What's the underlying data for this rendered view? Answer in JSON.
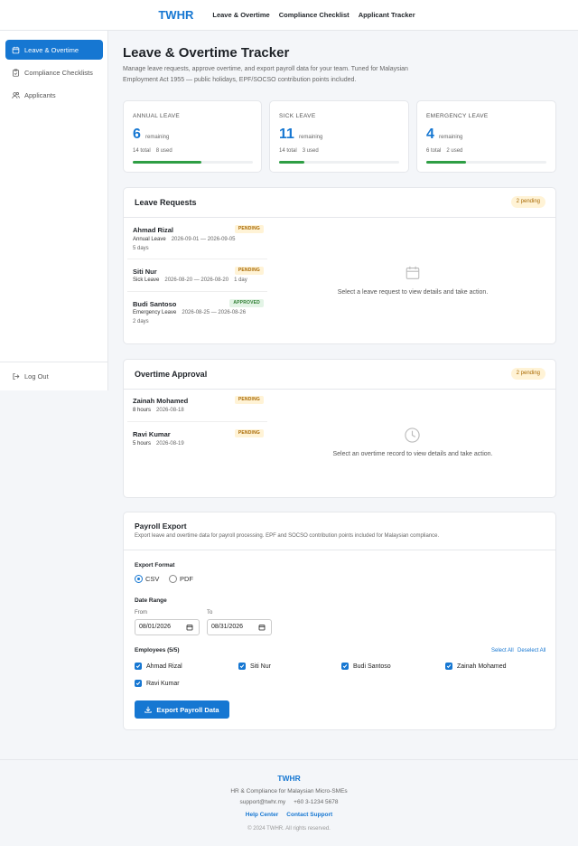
{
  "topnav": {
    "brand": "TWHR",
    "links": [
      "Leave & Overtime",
      "Compliance Checklist",
      "Applicant Tracker"
    ]
  },
  "sidebar": {
    "items": [
      {
        "label": "Leave & Overtime",
        "icon": "calendar-icon",
        "active": true
      },
      {
        "label": "Compliance Checklists",
        "icon": "clipboard-icon"
      },
      {
        "label": "Applicants",
        "icon": "users-icon"
      }
    ],
    "logout": "Log Out"
  },
  "page": {
    "title": "Leave & Overtime Tracker",
    "description": "Manage leave requests, approve overtime, and export payroll data for your team. Tuned for Malaysian Employment Act 1955 — public holidays, EPF/SOCSO contribution points included."
  },
  "stats": [
    {
      "label": "ANNUAL LEAVE",
      "value": "6",
      "remaining": "remaining",
      "total": "14 total",
      "used": "8 used",
      "progress": 0.57
    },
    {
      "label": "SICK LEAVE",
      "value": "11",
      "remaining": "remaining",
      "total": "14 total",
      "used": "3 used",
      "progress": 0.21
    },
    {
      "label": "EMERGENCY LEAVE",
      "value": "4",
      "remaining": "remaining",
      "total": "6 total",
      "used": "2 used",
      "progress": 0.33
    }
  ],
  "leave": {
    "title": "Leave Requests",
    "pending": "2 pending",
    "rows": [
      {
        "name": "Ahmad Rizal",
        "status": "PENDING",
        "type": "Annual Leave",
        "dates": "2026-09-01 — 2026-09-05",
        "days": "5 days"
      },
      {
        "name": "Siti Nur",
        "status": "PENDING",
        "type": "Sick Leave",
        "dates": "2026-08-20 — 2026-08-20",
        "days": "1 day"
      },
      {
        "name": "Budi Santoso",
        "status": "APPROVED",
        "type": "Emergency Leave",
        "dates": "2026-08-25 — 2026-08-26",
        "days": "2 days"
      }
    ],
    "empty": "Select a leave request to view details and take action."
  },
  "overtime": {
    "title": "Overtime Approval",
    "pending": "2 pending",
    "rows": [
      {
        "name": "Zainah Mohamed",
        "status": "PENDING",
        "hours": "8 hours",
        "date": "2026-08-18"
      },
      {
        "name": "Ravi Kumar",
        "status": "PENDING",
        "hours": "5 hours",
        "date": "2026-08-19"
      }
    ],
    "empty": "Select an overtime record to view details and take action."
  },
  "payroll": {
    "title": "Payroll Export",
    "description": "Export leave and overtime data for payroll processing. EPF and SOCSO contribution points included for Malaysian compliance.",
    "format_label": "Export Format",
    "formats": [
      "CSV",
      "PDF"
    ],
    "selected_format": "CSV",
    "range_label": "Date Range",
    "from_label": "From",
    "to_label": "To",
    "from": "08/01/2026",
    "to": "08/31/2026",
    "employees_label": "Employees (5/5)",
    "select_all": "Select All",
    "deselect_all": "Deselect All",
    "employees": [
      "Ahmad Rizal",
      "Siti Nur",
      "Budi Santoso",
      "Zainah Mohamed",
      "Ravi Kumar"
    ],
    "export_button": "Export Payroll Data"
  },
  "footer": {
    "brand": "TWHR",
    "tagline": "HR & Compliance for Malaysian Micro-SMEs",
    "email": "support@twhr.my",
    "phone": "+60 3-1234 5678",
    "links": [
      "Help Center",
      "Contact Support"
    ],
    "copyright": "© 2024 TWHR. All rights reserved."
  },
  "colors": {
    "accent": "#1677d2",
    "success": "#2e9e44",
    "pending_bg": "#fff3d6",
    "pending_fg": "#a86800"
  }
}
